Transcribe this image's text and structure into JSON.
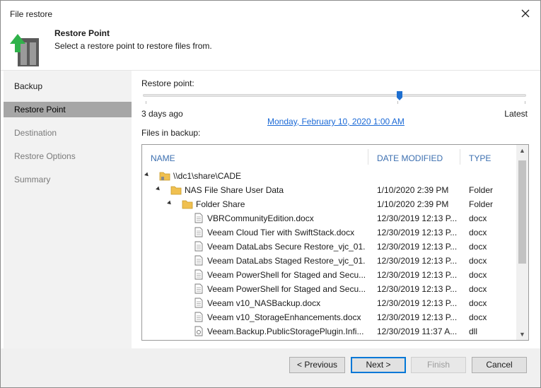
{
  "window": {
    "title": "File restore"
  },
  "header": {
    "title": "Restore Point",
    "subtitle": "Select a restore point to restore files from."
  },
  "sidebar": {
    "items": [
      {
        "label": "Backup",
        "state": "normal"
      },
      {
        "label": "Restore Point",
        "state": "active"
      },
      {
        "label": "Destination",
        "state": "muted"
      },
      {
        "label": "Restore Options",
        "state": "muted"
      },
      {
        "label": "Summary",
        "state": "muted"
      }
    ]
  },
  "restore_point": {
    "label": "Restore point:",
    "range_start": "3 days ago",
    "range_end": "Latest",
    "selected_date": "Monday, February 10, 2020 1:00 AM",
    "slider_position_fraction": 0.67
  },
  "files": {
    "label": "Files in backup:",
    "columns": {
      "name": "NAME",
      "date": "DATE MODIFIED",
      "type": "TYPE"
    },
    "rows": [
      {
        "name": "\\\\dc1\\share\\CADE",
        "date": "",
        "type": "",
        "kind": "share",
        "level": 0
      },
      {
        "name": "NAS File Share User Data",
        "date": "1/10/2020 2:39 PM",
        "type": "Folder",
        "kind": "folder",
        "level": 1
      },
      {
        "name": "Folder Share",
        "date": "1/10/2020 2:39 PM",
        "type": "Folder",
        "kind": "folder",
        "level": 2
      },
      {
        "name": "VBRCommunityEdition.docx",
        "date": "12/30/2019 12:13 P...",
        "type": "docx",
        "kind": "doc",
        "level": 3
      },
      {
        "name": "Veeam Cloud Tier with SwiftStack.docx",
        "date": "12/30/2019 12:13 P...",
        "type": "docx",
        "kind": "doc",
        "level": 3
      },
      {
        "name": "Veeam DataLabs Secure Restore_vjc_01...",
        "date": "12/30/2019 12:13 P...",
        "type": "docx",
        "kind": "doc",
        "level": 3
      },
      {
        "name": "Veeam DataLabs Staged Restore_vjc_01...",
        "date": "12/30/2019 12:13 P...",
        "type": "docx",
        "kind": "doc",
        "level": 3
      },
      {
        "name": "Veeam PowerShell for Staged and Secu...",
        "date": "12/30/2019 12:13 P...",
        "type": "docx",
        "kind": "doc",
        "level": 3
      },
      {
        "name": "Veeam PowerShell for Staged and Secu...",
        "date": "12/30/2019 12:13 P...",
        "type": "docx",
        "kind": "doc",
        "level": 3
      },
      {
        "name": "Veeam v10_NASBackup.docx",
        "date": "12/30/2019 12:13 P...",
        "type": "docx",
        "kind": "doc",
        "level": 3
      },
      {
        "name": "Veeam v10_StorageEnhancements.docx",
        "date": "12/30/2019 12:13 P...",
        "type": "docx",
        "kind": "doc",
        "level": 3
      },
      {
        "name": "Veeam.Backup.PublicStoragePlugin.Infi...",
        "date": "12/30/2019 11:37 A...",
        "type": "dll",
        "kind": "dll",
        "level": 3
      }
    ]
  },
  "buttons": {
    "previous": "< Previous",
    "next": "Next >",
    "finish": "Finish",
    "cancel": "Cancel"
  },
  "colors": {
    "accent": "#0078d7",
    "link": "#1c6ad6",
    "header_text": "#3c6fb0",
    "selected_sidebar": "#a6a6a6",
    "folder": "#f0c050"
  }
}
